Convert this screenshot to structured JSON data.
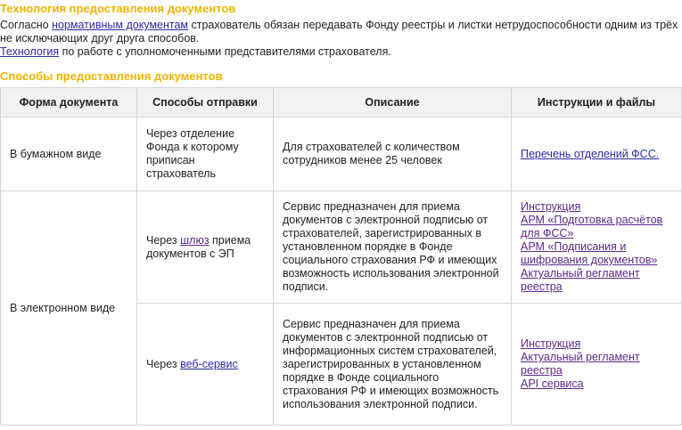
{
  "section1": {
    "title": "Технология предоставления документов",
    "p1_before": "Согласно ",
    "p1_link": "нормативным документам",
    "p1_after": " страхователь обязан передавать Фонду реестры и листки нетрудоспособности одним из трёх не исключающих друг друга способов.",
    "p2_link": "Технология",
    "p2_after": " по работе с уполномоченными представителями страхователя."
  },
  "section2": {
    "title": "Способы предоставления документов"
  },
  "table": {
    "headers": [
      "Форма документа",
      "Способы отправки",
      "Описание",
      "Инструкции и файлы"
    ],
    "row1": {
      "form": "В бумажном виде",
      "method": "Через отделение Фонда к которому приписан страхователь",
      "description": "Для страхователей с количеством сотрудников менее 25 человек",
      "file1": "Перечень отделений ФСС."
    },
    "electronic_form": "В электронном виде",
    "row2": {
      "method_before": "Через ",
      "method_link": "шлюз",
      "method_after": " приема документов с ЭП",
      "description": "Сервис предназначен для приема документов с электронной подписью от страхователей, зарегистрированных в установленном порядке в Фонде социального страхования РФ и имеющих возможность использования электронной подписи.",
      "file1": "Инструкция",
      "file2": "АРМ «Подготовка расчётов для ФСС»",
      "file3": "АРМ «Подписания и шифрования документов»",
      "file4": "Актуальный регламент реестра"
    },
    "row3": {
      "method_before": "Через ",
      "method_link": "веб-сервис",
      "description": "Сервис предназначен для приема документов с электронной подписью от информационных систем страхователей, зарегистрированных в установленном порядке в Фонде социального страхования РФ и имеющих возможность использования электронной подписи.",
      "file1": "Инструкция",
      "file2": "Актуальный регламент реестра",
      "file3": "API сервиса"
    }
  }
}
